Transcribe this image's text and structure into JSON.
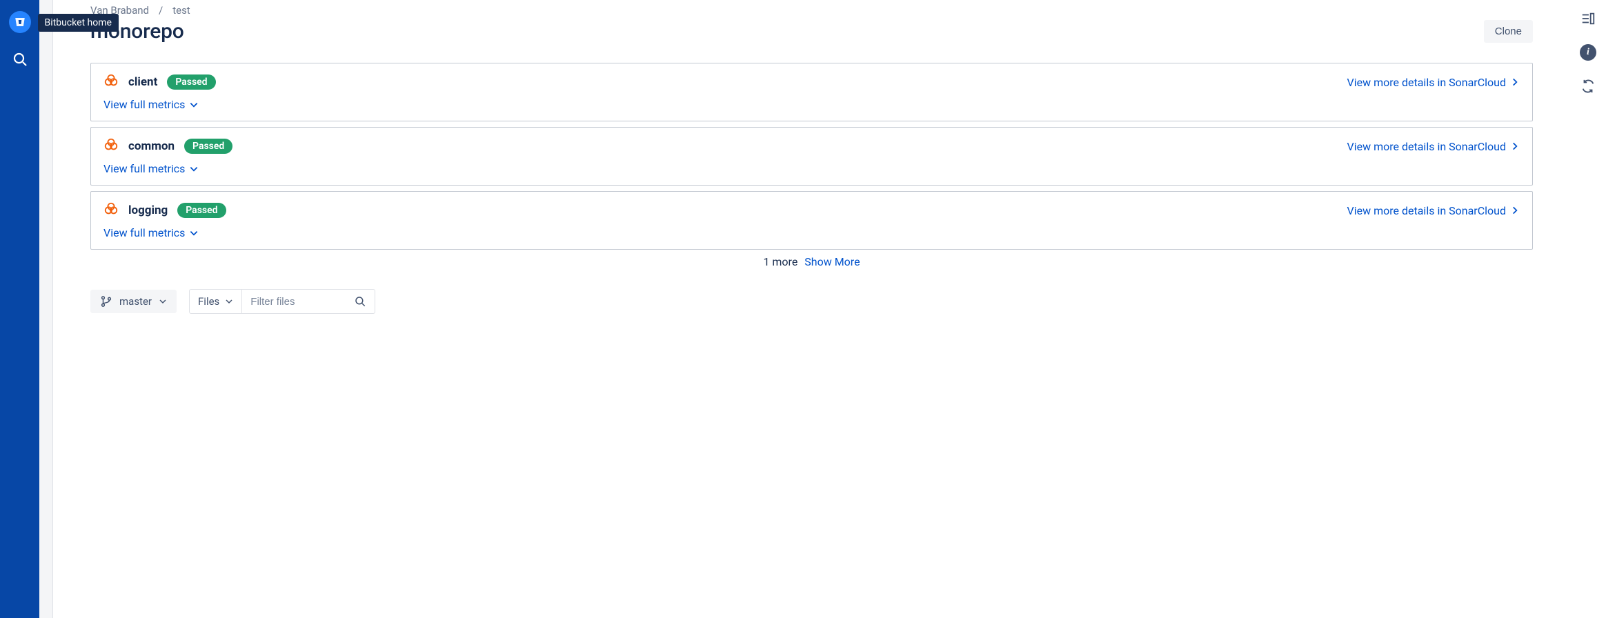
{
  "tooltip": {
    "home": "Bitbucket home"
  },
  "breadcrumb": {
    "owner": "Van Braband",
    "project": "test"
  },
  "page": {
    "title": "monorepo"
  },
  "actions": {
    "clone": "Clone"
  },
  "cards": [
    {
      "name": "client",
      "status": "Passed",
      "details": "View more details in SonarCloud",
      "metrics": "View full metrics"
    },
    {
      "name": "common",
      "status": "Passed",
      "details": "View more details in SonarCloud",
      "metrics": "View full metrics"
    },
    {
      "name": "logging",
      "status": "Passed",
      "details": "View more details in SonarCloud",
      "metrics": "View full metrics"
    }
  ],
  "pagination": {
    "more_count": "1 more",
    "show_more": "Show More"
  },
  "source": {
    "branch": "master",
    "scope": "Files",
    "filter_placeholder": "Filter files"
  }
}
